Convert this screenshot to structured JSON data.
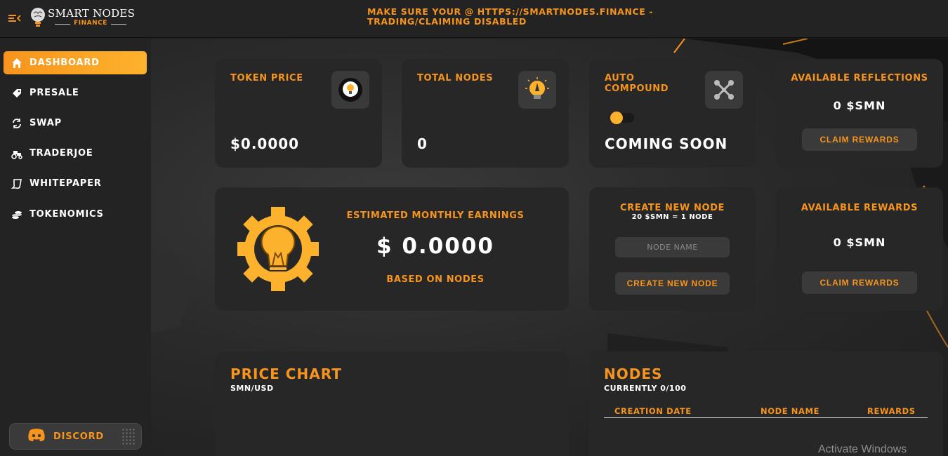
{
  "brand": {
    "name": "SMART NODES",
    "sub": "FINANCE"
  },
  "notice": "MAKE SURE YOUR @ HTTPS://SMARTNODES.FINANCE - TRADING/CLAIMING DISABLED",
  "sidebar": {
    "items": [
      {
        "label": "DASHBOARD",
        "icon": "home-icon",
        "active": true
      },
      {
        "label": "PRESALE",
        "icon": "tag-icon"
      },
      {
        "label": "SWAP",
        "icon": "swap-icon"
      },
      {
        "label": "TRADERJOE",
        "icon": "tractor-icon"
      },
      {
        "label": "WHITEPAPER",
        "icon": "paper-icon"
      },
      {
        "label": "TOKENOMICS",
        "icon": "coins-icon"
      }
    ],
    "discord_label": "DISCORD"
  },
  "cards": {
    "token_price": {
      "title": "TOKEN PRICE",
      "value": "$0.0000"
    },
    "total_nodes": {
      "title": "TOTAL NODES",
      "value": "0"
    },
    "auto_compound": {
      "title": "AUTO COMPOUND",
      "status": "COMING SOON"
    },
    "available_reflections": {
      "title": "AVAILABLE REFLECTIONS",
      "value": "0 $SMN",
      "button": "CLAIM REWARDS"
    },
    "earnings": {
      "title": "ESTIMATED MONTHLY EARNINGS",
      "value": "$ 0.0000",
      "note": "BASED ON NODES"
    },
    "create_node": {
      "title": "CREATE NEW NODE",
      "subtitle": "20 $SMN = 1 NODE",
      "placeholder": "NODE NAME",
      "button": "CREATE NEW NODE"
    },
    "available_rewards": {
      "title": "AVAILABLE REWARDS",
      "value": "0 $SMN",
      "button": "CLAIM REWARDS"
    },
    "price_chart": {
      "title": "PRICE CHART",
      "pair": "SMN/USD"
    },
    "nodes": {
      "title": "NODES",
      "currently": "CURRENTLY 0/100",
      "columns": [
        "CREATION DATE",
        "NODE NAME",
        "REWARDS"
      ]
    }
  },
  "watermark": "Activate Windows",
  "colors": {
    "accent": "#f7941d",
    "accent_light": "#fdb22d",
    "card": "#272727",
    "sidebar": "#232323"
  }
}
